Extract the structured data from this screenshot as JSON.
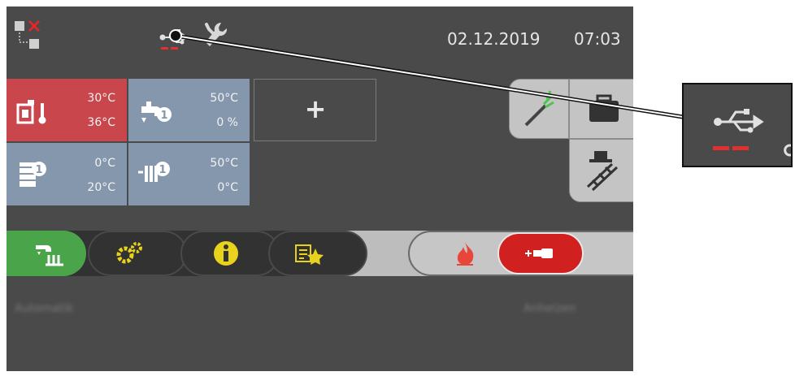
{
  "header": {
    "date": "02.12.2019",
    "time": "07:03",
    "icons": [
      "network-disconnected-icon",
      "usb-icon",
      "wrench-icon"
    ]
  },
  "tiles": [
    {
      "icon": "boiler-thermometer-icon",
      "top_value": "30°C",
      "bottom_value": "36°C",
      "color": "#c9464c"
    },
    {
      "icon": "hot-water-tap-icon",
      "top_value": "50°C",
      "bottom_value": "0 %",
      "color": "#8597ad"
    },
    {
      "icon": "buffer-tank-icon",
      "top_value": "0°C",
      "bottom_value": "20°C",
      "color": "#8597ad"
    },
    {
      "icon": "heating-circuit-icon",
      "top_value": "50°C",
      "bottom_value": "0°C",
      "color": "#8597ad"
    }
  ],
  "add_tile": {
    "label": "+"
  },
  "side_buttons": [
    "chimney-sweep-brush-icon",
    "suitcase-icon",
    "chimney-sweep-icon"
  ],
  "mode_bar": {
    "buttons": [
      "auto-mode-icon",
      "settings-gears-icon",
      "info-icon",
      "favorites-star-icon"
    ],
    "active_color": "#4aa54a",
    "status_icons": [
      "flame-icon",
      "ignition-icon"
    ],
    "status_active_color": "#d02020"
  },
  "captions": {
    "left": "Automatik",
    "right": "Anheizen"
  }
}
